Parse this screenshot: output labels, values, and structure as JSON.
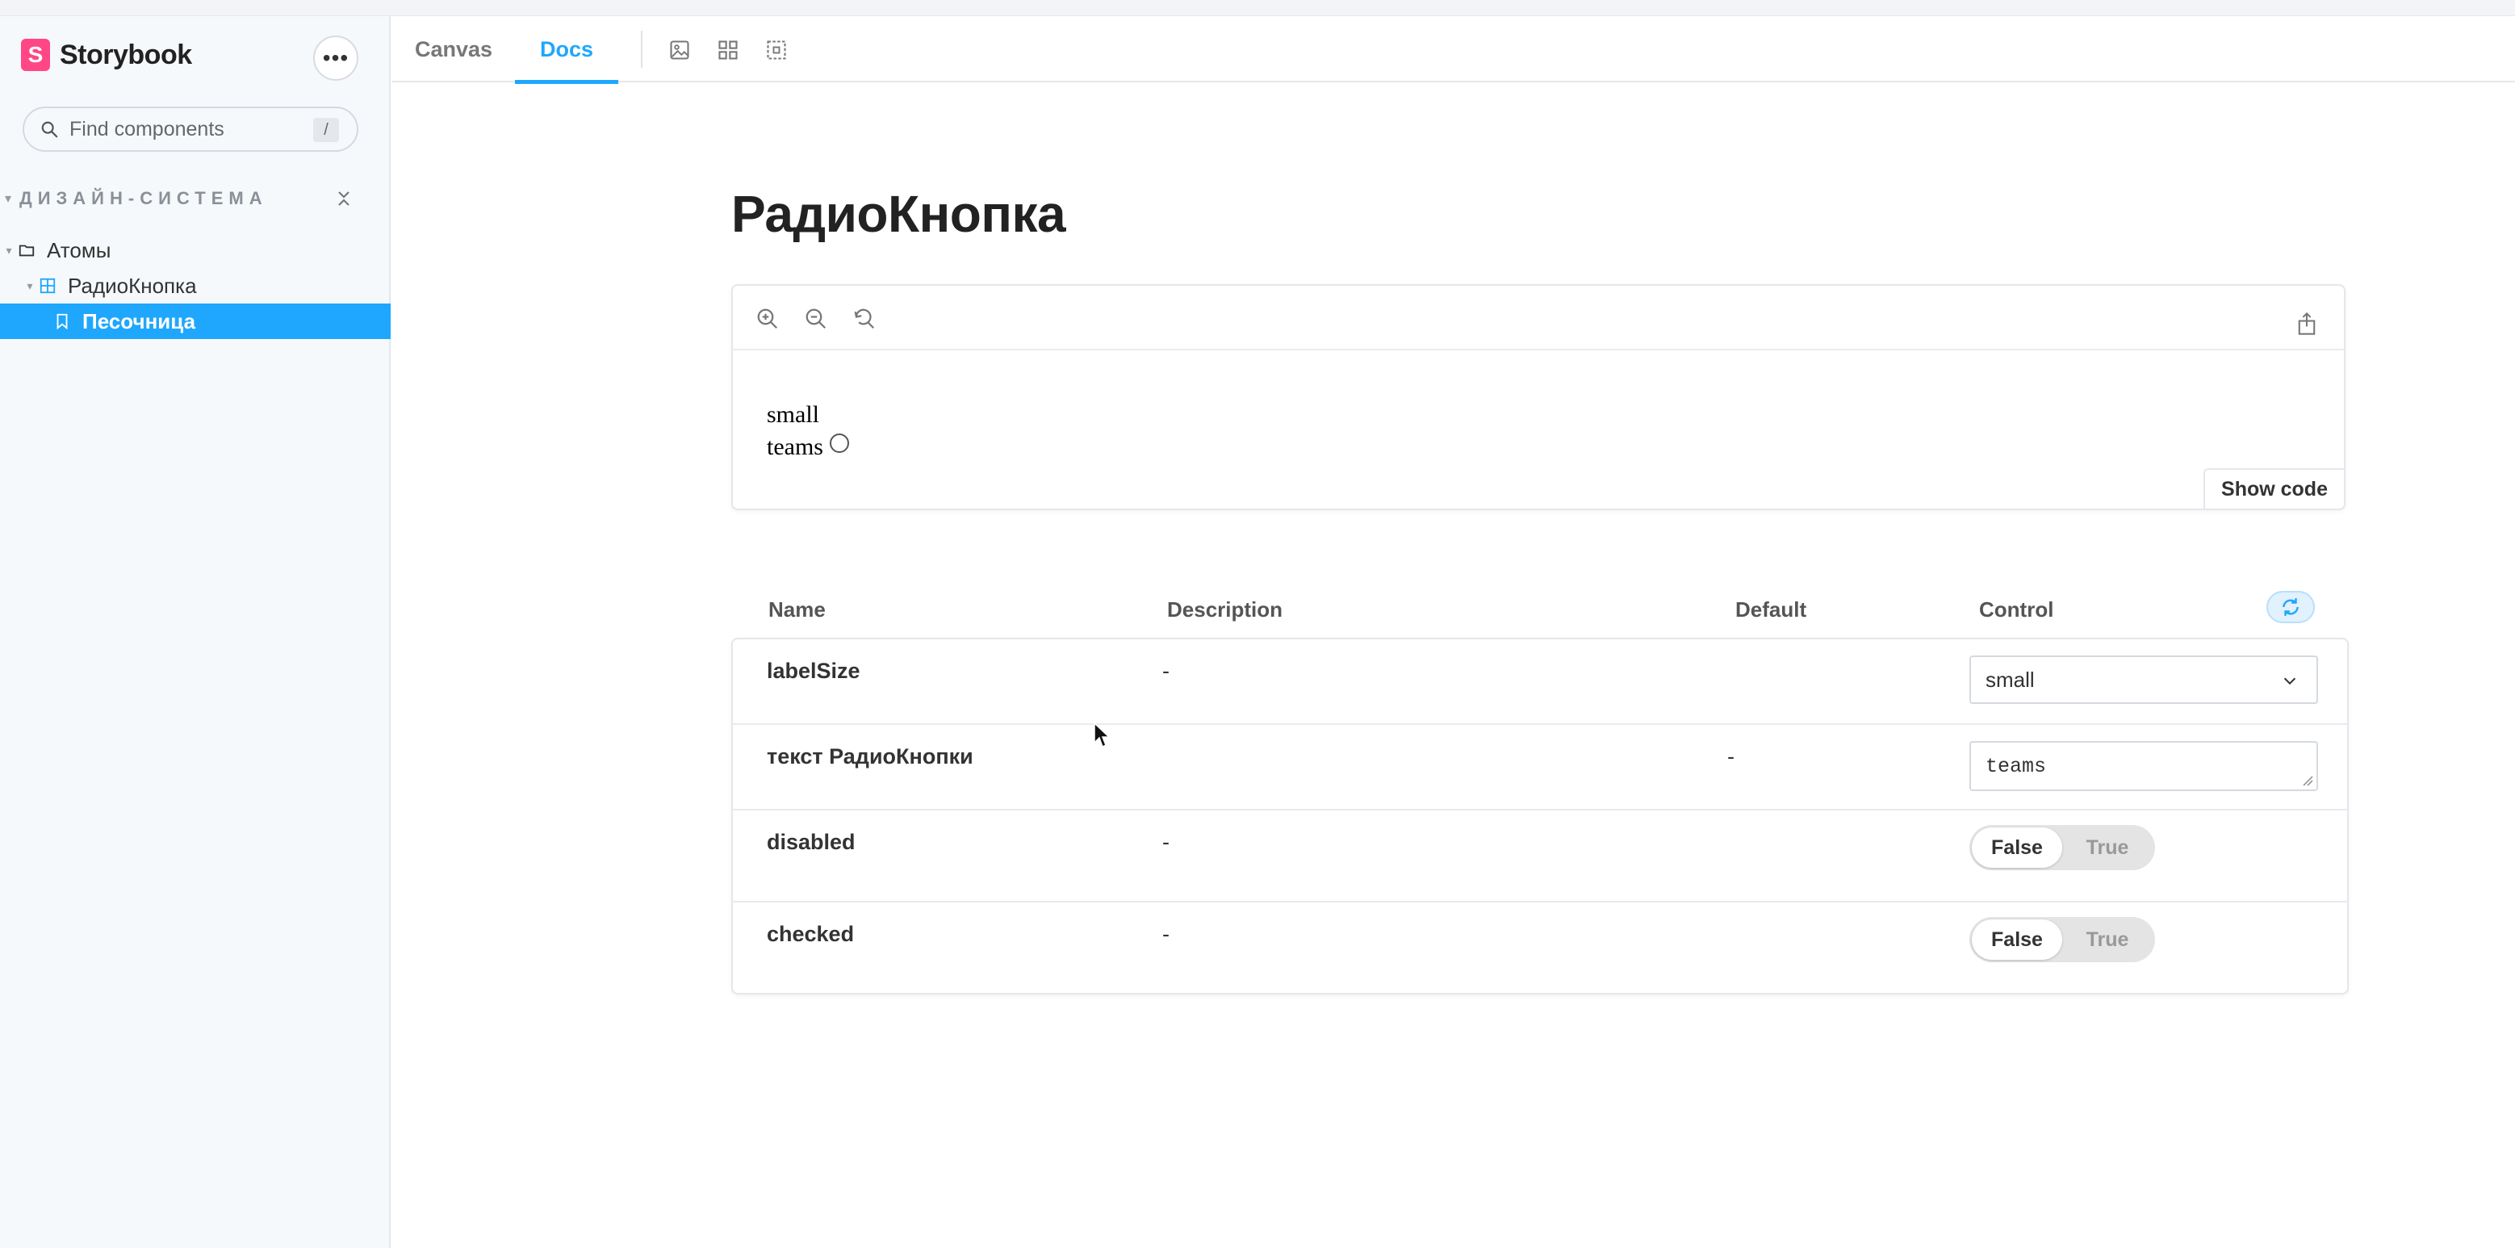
{
  "brand": {
    "name": "Storybook",
    "logo_letter": "S",
    "accent": "#ff4785"
  },
  "sidebar": {
    "menu_icon": "ellipsis-icon",
    "search": {
      "placeholder": "Find components",
      "shortcut": "/"
    },
    "section": {
      "title": "ДИЗАЙН-СИСТЕМА"
    },
    "tree": [
      {
        "label": "Атомы",
        "icon": "folder-icon"
      },
      {
        "label": "РадиоКнопка",
        "icon": "component-icon"
      },
      {
        "label": "Песочница",
        "icon": "bookmark-icon",
        "selected": true
      }
    ],
    "selected_color": "#1ea7fd"
  },
  "toolbar": {
    "tabs": [
      {
        "label": "Canvas"
      },
      {
        "label": "Docs",
        "active": true
      }
    ],
    "icons": [
      "image-icon",
      "grid-icon",
      "outline-icon"
    ]
  },
  "docs": {
    "title": "РадиоКнопка",
    "preview": {
      "zoom_icons": [
        "zoom-in-icon",
        "zoom-out-icon",
        "zoom-reset-icon"
      ],
      "share_icon": "share-icon",
      "story_label_size": "small",
      "story_text": "teams",
      "show_code_label": "Show code"
    },
    "args": {
      "headers": {
        "name": "Name",
        "description": "Description",
        "default": "Default",
        "control": "Control"
      },
      "rows": [
        {
          "name": "labelSize",
          "description": "-",
          "default": "",
          "control": {
            "type": "select",
            "value": "small"
          }
        },
        {
          "name": "текст РадиоКнопки",
          "description": "",
          "default": "-",
          "control": {
            "type": "text",
            "value": "teams"
          }
        },
        {
          "name": "disabled",
          "description": "-",
          "default": "",
          "control": {
            "type": "boolean",
            "false_label": "False",
            "true_label": "True",
            "value": false
          }
        },
        {
          "name": "checked",
          "description": "-",
          "default": "",
          "control": {
            "type": "boolean",
            "false_label": "False",
            "true_label": "True",
            "value": false
          }
        }
      ]
    }
  }
}
